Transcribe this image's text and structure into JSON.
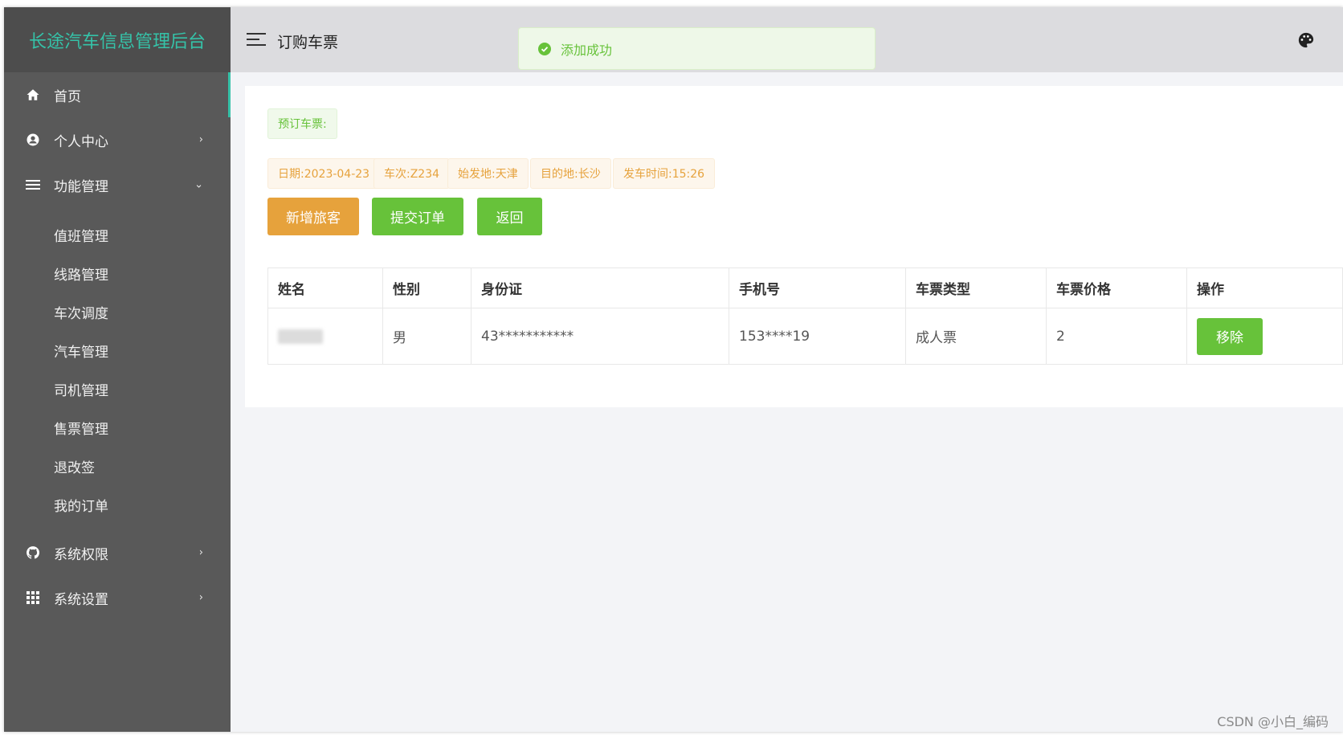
{
  "app": {
    "title": "长途汽车信息管理后台",
    "accent": "#35c2a8"
  },
  "sidebar": {
    "items": [
      {
        "label": "首页",
        "icon": "home-icon"
      },
      {
        "label": "个人中心",
        "icon": "user-circle-icon"
      },
      {
        "label": "功能管理",
        "icon": "menu-icon"
      },
      {
        "label": "系统权限",
        "icon": "github-icon"
      },
      {
        "label": "系统设置",
        "icon": "grid-icon"
      }
    ],
    "subitems": [
      "值班管理",
      "线路管理",
      "车次调度",
      "汽车管理",
      "司机管理",
      "售票管理",
      "退改签",
      "我的订单"
    ]
  },
  "header": {
    "title": "订购车票"
  },
  "toast": {
    "message": "添加成功",
    "type": "success"
  },
  "booking": {
    "tag": "预订车票:",
    "info": [
      "日期:2023-04-23",
      "车次:Z234",
      "始发地:天津",
      "目的地:长沙",
      "发车时间:15:26"
    ]
  },
  "actions": {
    "add_passenger": "新增旅客",
    "submit_order": "提交订单",
    "back": "返回"
  },
  "table": {
    "headers": [
      "姓名",
      "性别",
      "身份证",
      "手机号",
      "车票类型",
      "车票价格",
      "操作"
    ],
    "rows": [
      {
        "gender": "男",
        "id_card": "43***********",
        "phone": "153****19",
        "ticket_type": "成人票",
        "price": "2",
        "action": "移除"
      }
    ]
  },
  "watermark": "CSDN @小白_编码"
}
